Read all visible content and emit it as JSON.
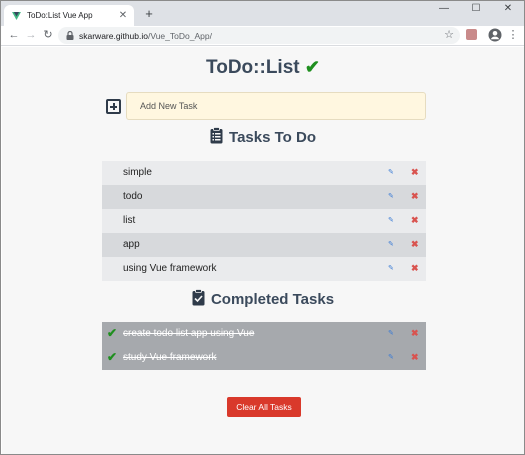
{
  "browser": {
    "tab_title": "ToDo:List Vue App",
    "new_tab": "+",
    "url_host": "skarware.github.io",
    "url_path": "/Vue_ToDo_App/"
  },
  "app": {
    "title": "ToDo::List",
    "add_placeholder": "Add New Task",
    "todo_heading": "Tasks To Do",
    "completed_heading": "Completed Tasks",
    "clear_button": "Clear All Tasks"
  },
  "todo_tasks": [
    {
      "text": "simple"
    },
    {
      "text": "todo"
    },
    {
      "text": "list"
    },
    {
      "text": "app"
    },
    {
      "text": "using Vue framework"
    }
  ],
  "completed_tasks": [
    {
      "text": "create todo list app using Vue"
    },
    {
      "text": "study Vue framework"
    }
  ],
  "colors": {
    "accent_check": "#1f8f1f",
    "delete": "#d9534f",
    "clear_button": "#d9392b",
    "heading": "#3b4a5c"
  },
  "icons": [
    "vue-favicon",
    "close-icon",
    "back-icon",
    "forward-icon",
    "reload-icon",
    "lock-icon",
    "star-icon",
    "profile-icon",
    "menu-icon",
    "checkmark-icon",
    "plus-square-icon",
    "clipboard-list-icon",
    "clipboard-check-icon",
    "edit-icon",
    "delete-icon"
  ]
}
